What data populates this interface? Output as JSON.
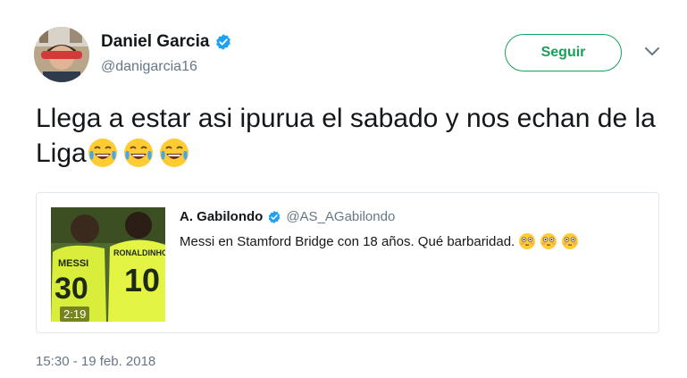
{
  "author": {
    "name": "Daniel Garcia",
    "handle": "@danigarcia16",
    "verified_icon": "verified-badge-icon"
  },
  "follow_label": "Seguir",
  "tweet": {
    "text": "Llega a estar asi ipurua el sabado y nos echan de la Liga",
    "emojis": [
      "joy-emoji-icon",
      "joy-emoji-icon",
      "joy-emoji-icon"
    ]
  },
  "quoted": {
    "name": "A. Gabilondo",
    "handle": "@AS_AGabilondo",
    "text": "Messi en Stamford Bridge con 18 años. Qué barbaridad.",
    "emojis": [
      "flushed-emoji-icon",
      "flushed-emoji-icon",
      "flushed-emoji-icon"
    ],
    "video_duration": "2:19",
    "jersey_1_name": "MESSI",
    "jersey_1_number": "30",
    "jersey_2_name": "RONALDINHO",
    "jersey_2_number": "10"
  },
  "timestamp": "15:30 - 19 feb. 2018",
  "colors": {
    "accent": "#17a05a",
    "verified": "#1da1f2",
    "secondary_text": "#657786"
  }
}
